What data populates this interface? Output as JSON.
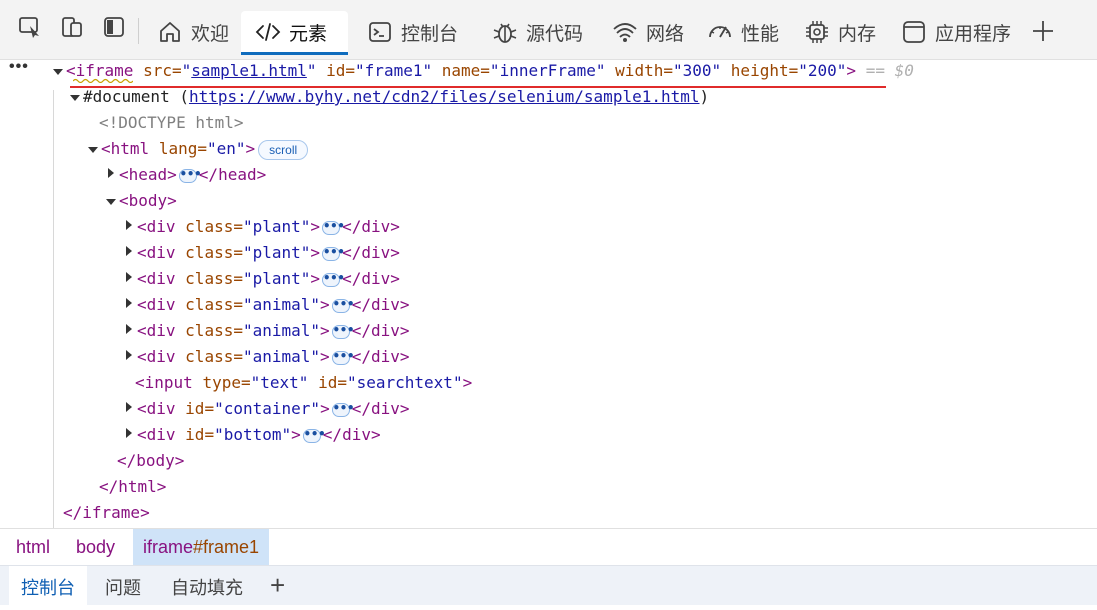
{
  "toolbar": {
    "inspect_icon": "inspect-element-icon",
    "device_icon": "device-emulation-icon",
    "sidebar_icon": "toggle-sidebar-icon",
    "tabs": [
      {
        "label": "欢迎",
        "icon": "home-icon"
      },
      {
        "label": "元素",
        "icon": "code-icon",
        "active": true
      },
      {
        "label": "控制台",
        "icon": "console-icon"
      },
      {
        "label": "源代码",
        "icon": "bug-icon"
      },
      {
        "label": "网络",
        "icon": "wifi-icon"
      },
      {
        "label": "性能",
        "icon": "gauge-icon"
      },
      {
        "label": "内存",
        "icon": "chip-icon"
      },
      {
        "label": "应用程序",
        "icon": "app-window-icon"
      }
    ],
    "add_tab_label": "+"
  },
  "tree": {
    "dots": "•••",
    "iframe_line": {
      "open": "<iframe",
      "src_attr": "src=",
      "src_val": "sample1.html",
      "id_attr": "id=",
      "id_val": "frame1",
      "name_attr": "name=",
      "name_val": "innerFrame",
      "width_attr": "width=",
      "width_val": "300",
      "height_attr": "height=",
      "height_val": "200",
      "close": ">",
      "selection_marker": "== $0"
    },
    "document_label": "#document (",
    "document_url": "https://www.byhy.net/cdn2/files/selenium/sample1.html",
    "document_close": ")",
    "doctype": "<!DOCTYPE html>",
    "html_open": "<html",
    "html_lang_attr": "lang=",
    "html_lang_val": "en",
    "html_gt": ">",
    "scroll_badge": "scroll",
    "head_open": "<head>",
    "head_close": "</head>",
    "body_open": "<body>",
    "children": [
      {
        "attr": "class=",
        "val": "plant"
      },
      {
        "attr": "class=",
        "val": "plant"
      },
      {
        "attr": "class=",
        "val": "plant"
      },
      {
        "attr": "class=",
        "val": "animal"
      },
      {
        "attr": "class=",
        "val": "animal"
      },
      {
        "attr": "class=",
        "val": "animal"
      }
    ],
    "div_open": "<div",
    "div_close": "</div>",
    "ellipsis": "•••",
    "input_line": {
      "open": "<input",
      "type_attr": "type=",
      "type_val": "text",
      "id_attr": "id=",
      "id_val": "searchtext",
      "close": ">"
    },
    "container_div": {
      "attr": "id=",
      "val": "container"
    },
    "bottom_div": {
      "attr": "id=",
      "val": "bottom"
    },
    "body_close": "</body>",
    "html_close": "</html>",
    "iframe_close": "</iframe>"
  },
  "breadcrumb": {
    "items": [
      "html",
      "body"
    ],
    "active_tag": "iframe",
    "active_id": "#frame1"
  },
  "drawer": {
    "tabs": [
      "控制台",
      "问题",
      "自动填充"
    ],
    "add_label": "+"
  },
  "colors": {
    "accent": "#0f6cbd",
    "tag": "#881280",
    "attr": "#994500",
    "value": "#1a1aa6",
    "selection_underline": "#e02b2b"
  }
}
